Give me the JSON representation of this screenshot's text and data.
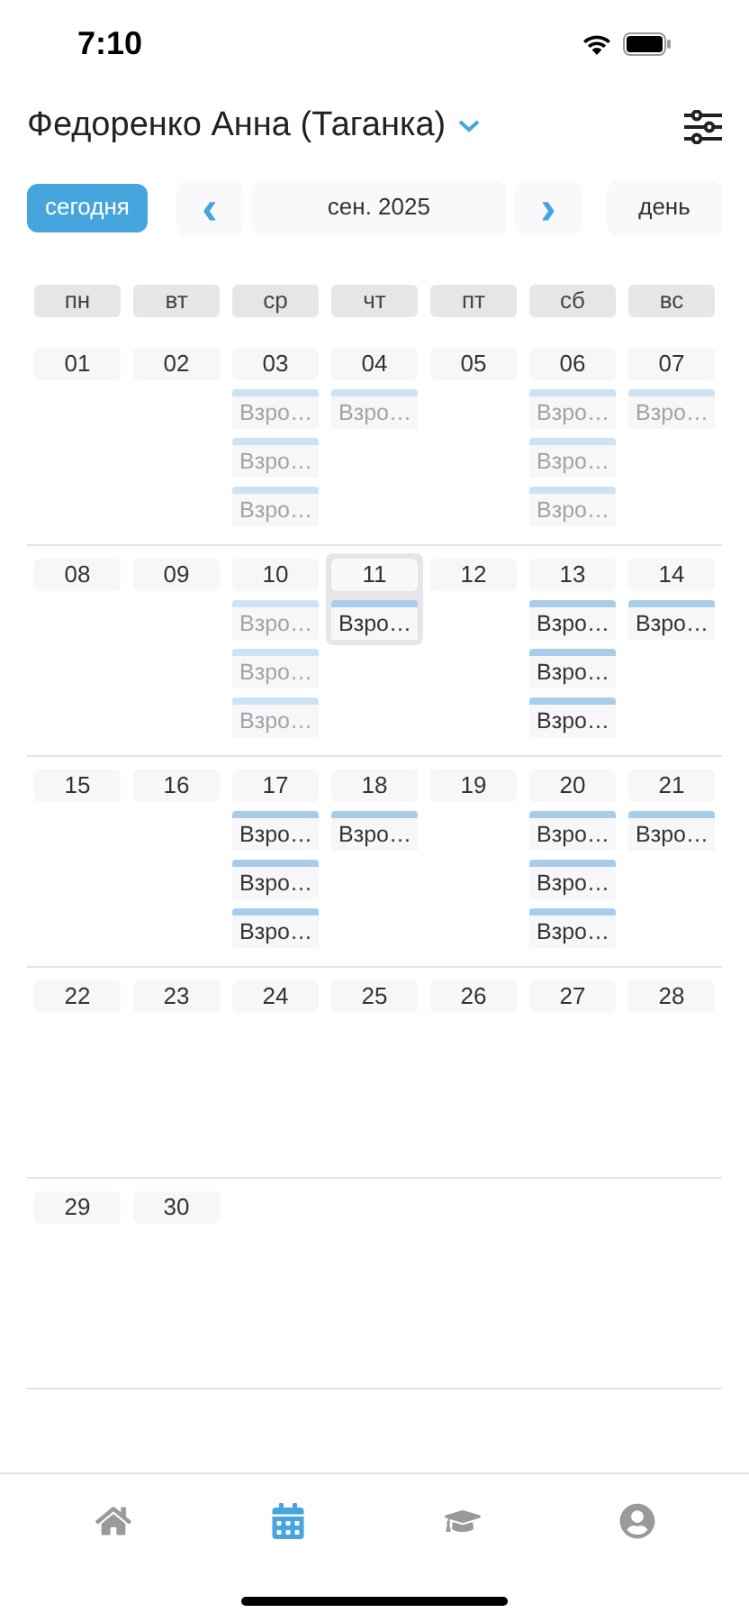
{
  "status_bar": {
    "time": "7:10"
  },
  "header": {
    "title": "Федоренко Анна (Таганка)"
  },
  "toolbar": {
    "today": "сегодня",
    "prev": "‹",
    "month": "сен. 2025",
    "next": "›",
    "view": "день"
  },
  "weekdays": [
    "пн",
    "вт",
    "ср",
    "чт",
    "пт",
    "сб",
    "вс"
  ],
  "weeks": [
    [
      {
        "day": "01",
        "selected": false
      },
      {
        "day": "02",
        "selected": false
      },
      {
        "day": "03",
        "selected": false,
        "events": [
          {
            "label": "Взро…",
            "past": true
          },
          {
            "label": "Взро…",
            "past": true
          },
          {
            "label": "Взро…",
            "past": true
          }
        ]
      },
      {
        "day": "04",
        "selected": false,
        "events": [
          {
            "label": "Взро…",
            "past": true
          }
        ]
      },
      {
        "day": "05",
        "selected": false
      },
      {
        "day": "06",
        "selected": false,
        "events": [
          {
            "label": "Взро…",
            "past": true
          },
          {
            "label": "Взро…",
            "past": true
          },
          {
            "label": "Взро…",
            "past": true
          }
        ]
      },
      {
        "day": "07",
        "selected": false,
        "events": [
          {
            "label": "Взро…",
            "past": true
          }
        ]
      }
    ],
    [
      {
        "day": "08",
        "selected": false
      },
      {
        "day": "09",
        "selected": false
      },
      {
        "day": "10",
        "selected": false,
        "events": [
          {
            "label": "Взро…",
            "past": true
          },
          {
            "label": "Взро…",
            "past": true
          },
          {
            "label": "Взро…",
            "past": true
          }
        ]
      },
      {
        "day": "11",
        "selected": true,
        "events": [
          {
            "label": "Взро…",
            "past": false
          }
        ]
      },
      {
        "day": "12",
        "selected": false
      },
      {
        "day": "13",
        "selected": false,
        "events": [
          {
            "label": "Взро…",
            "past": false
          },
          {
            "label": "Взро…",
            "past": false
          },
          {
            "label": "Взро…",
            "past": false
          }
        ]
      },
      {
        "day": "14",
        "selected": false,
        "events": [
          {
            "label": "Взро…",
            "past": false
          }
        ]
      }
    ],
    [
      {
        "day": "15",
        "selected": false
      },
      {
        "day": "16",
        "selected": false
      },
      {
        "day": "17",
        "selected": false,
        "events": [
          {
            "label": "Взро…",
            "past": false
          },
          {
            "label": "Взро…",
            "past": false
          },
          {
            "label": "Взро…",
            "past": false
          }
        ]
      },
      {
        "day": "18",
        "selected": false,
        "events": [
          {
            "label": "Взро…",
            "past": false
          }
        ]
      },
      {
        "day": "19",
        "selected": false
      },
      {
        "day": "20",
        "selected": false,
        "events": [
          {
            "label": "Взро…",
            "past": false
          },
          {
            "label": "Взро…",
            "past": false
          },
          {
            "label": "Взро…",
            "past": false
          }
        ]
      },
      {
        "day": "21",
        "selected": false,
        "events": [
          {
            "label": "Взро…",
            "past": false
          }
        ]
      }
    ],
    [
      {
        "day": "22",
        "selected": false
      },
      {
        "day": "23",
        "selected": false
      },
      {
        "day": "24",
        "selected": false
      },
      {
        "day": "25",
        "selected": false
      },
      {
        "day": "26",
        "selected": false
      },
      {
        "day": "27",
        "selected": false
      },
      {
        "day": "28",
        "selected": false
      }
    ],
    [
      {
        "day": "29",
        "selected": false
      },
      {
        "day": "30",
        "selected": false
      }
    ]
  ],
  "tab_bar": [
    {
      "kind": "home",
      "selected": false
    },
    {
      "kind": "calendar",
      "selected": true
    },
    {
      "kind": "education",
      "selected": false
    },
    {
      "kind": "profile",
      "selected": false
    }
  ]
}
